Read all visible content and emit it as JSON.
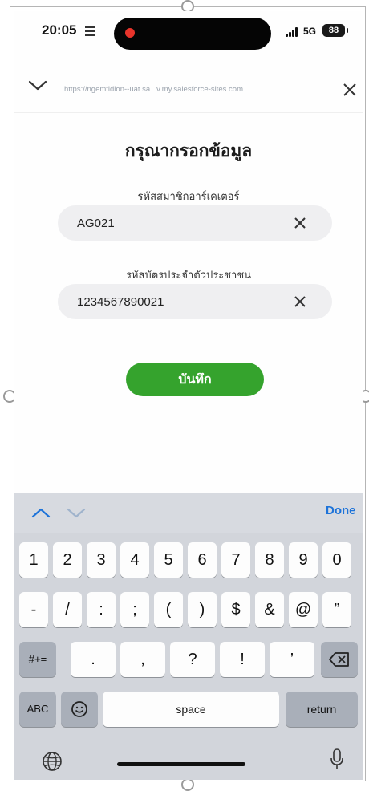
{
  "status_bar": {
    "time": "20:05",
    "network": "5G",
    "battery": "88",
    "recording_color": "#e8342b"
  },
  "browser": {
    "url": "https://ngemtidion--uat.sa...v.my.salesforce-sites.com"
  },
  "form": {
    "title": "กรุณากรอกข้อมูล",
    "fields": [
      {
        "label": "รหัสสมาชิกอาร์เคเตอร์",
        "value": "AG021"
      },
      {
        "label": "รหัสบัตรประจำตัวประชาชน",
        "value": "1234567890021"
      }
    ],
    "save_label": "บันทึก",
    "accent_color": "#35a32d"
  },
  "keyboard": {
    "done_label": "Done",
    "row1": [
      "1",
      "2",
      "3",
      "4",
      "5",
      "6",
      "7",
      "8",
      "9",
      "0"
    ],
    "row2": [
      "-",
      "/",
      ":",
      ";",
      "(",
      ")",
      "$",
      "&",
      "@",
      "”"
    ],
    "row3_left": "#+=",
    "row3": [
      ".",
      ",",
      "?",
      "!",
      "’"
    ],
    "abc_label": "ABC",
    "space_label": "space",
    "return_label": "return",
    "icons": [
      "chevron-up-icon",
      "chevron-down-icon",
      "backspace-icon",
      "emoji-icon",
      "globe-icon",
      "microphone-icon"
    ]
  }
}
